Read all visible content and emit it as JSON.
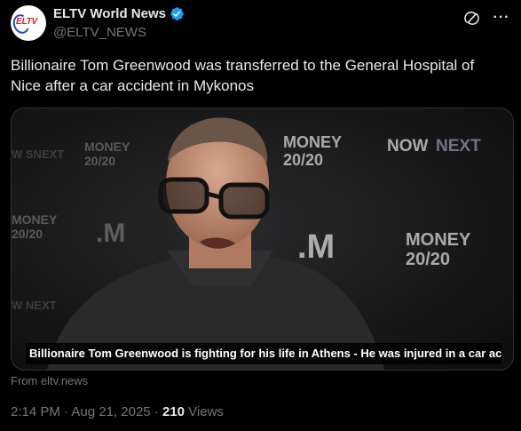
{
  "account": {
    "avatar_text": "ELTV",
    "display_name": "ELTV World News",
    "handle": "@ELTV_NEWS",
    "verified": true
  },
  "actions": {
    "grok_icon": "grok-icon",
    "more_icon": "more-icon",
    "more_label": "···"
  },
  "tweet": {
    "text": "Billionaire Tom Greenwood was transferred to the General Hospital of Nice after a car accident in Mykonos"
  },
  "media": {
    "backdrop_logos": [
      "MONEY 20/20",
      "NOW NEXT",
      "M"
    ],
    "caption": "Billionaire Tom Greenwood is fighting for his life in Athens - He was injured in a car acci..."
  },
  "source": "From eltv.news",
  "meta": {
    "time": "2:14 PM",
    "separator1": " · ",
    "date": "Aug 21, 2025",
    "separator2": " · ",
    "views_count": "210",
    "views_label": " Views"
  },
  "colors": {
    "background": "#000000",
    "text_primary": "#e7e9ea",
    "text_secondary": "#71767b",
    "verified_blue": "#1d9bf0",
    "border": "#2f3336"
  }
}
